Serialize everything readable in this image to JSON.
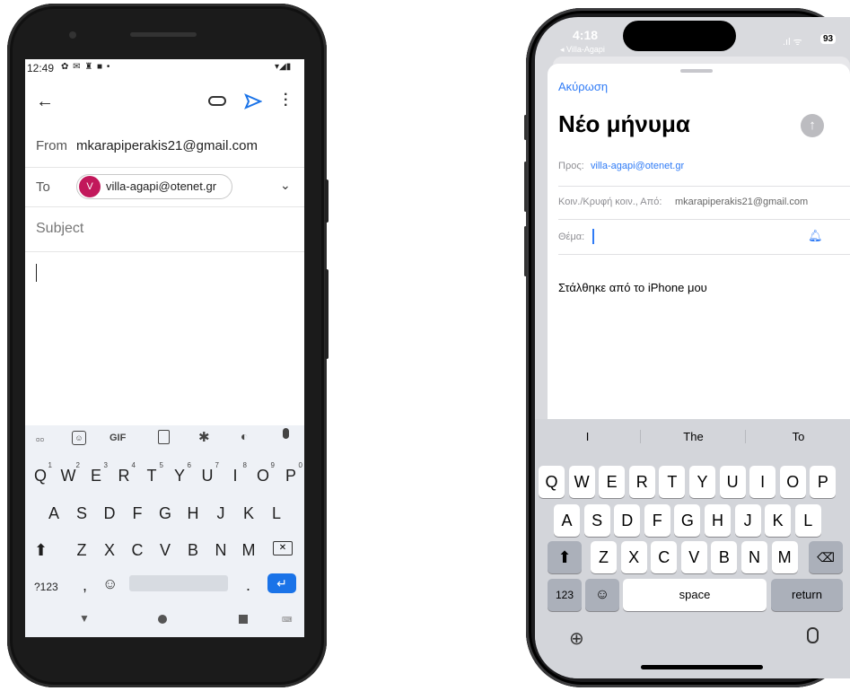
{
  "android": {
    "status": {
      "time": "12:49",
      "icons": "✿ ✉ ♜ ■ •",
      "right_icons": "▾◢▮"
    },
    "toolbar": {
      "back_icon": "arrow-left-icon",
      "attach_icon": "paperclip-icon",
      "send_icon": "send-icon",
      "more_icon": "more-vert-icon"
    },
    "from": {
      "label": "From",
      "value": "mkarapiperakis21@gmail.com"
    },
    "to": {
      "label": "To",
      "avatar_letter": "V",
      "chip": "villa-agapi@otenet.gr"
    },
    "subject_placeholder": "Subject",
    "keyboard": {
      "toolbar_gif": "GIF",
      "row1": [
        {
          "k": "Q",
          "n": "1"
        },
        {
          "k": "W",
          "n": "2"
        },
        {
          "k": "E",
          "n": "3"
        },
        {
          "k": "R",
          "n": "4"
        },
        {
          "k": "T",
          "n": "5"
        },
        {
          "k": "Y",
          "n": "6"
        },
        {
          "k": "U",
          "n": "7"
        },
        {
          "k": "I",
          "n": "8"
        },
        {
          "k": "O",
          "n": "9"
        },
        {
          "k": "P",
          "n": "0"
        }
      ],
      "row2": [
        "A",
        "S",
        "D",
        "F",
        "G",
        "H",
        "J",
        "K",
        "L"
      ],
      "row3": [
        "Z",
        "X",
        "C",
        "V",
        "B",
        "N",
        "M"
      ],
      "sym": "?123",
      "comma": ",",
      "period": "."
    },
    "accent": "#1a73e8",
    "avatar_color": "#c2185b"
  },
  "ios": {
    "status": {
      "time": "4:18",
      "back": "◂ Villa-Agapi",
      "battery": "93"
    },
    "cancel": "Ακύρωση",
    "title": "Νέο μήνυμα",
    "to": {
      "label": "Προς:",
      "value": "villa-agapi@otenet.gr"
    },
    "cc": {
      "label": "Κοιν./Κρυφή κοιν., Από:",
      "value": "mkarapiperakis21@gmail.com"
    },
    "subject_label": "Θέμα:",
    "signature": "Στάλθηκε από το iPhone μου",
    "suggestions": [
      "I",
      "The",
      "To"
    ],
    "row1": [
      "Q",
      "W",
      "E",
      "R",
      "T",
      "Y",
      "U",
      "I",
      "O",
      "P"
    ],
    "row2": [
      "A",
      "S",
      "D",
      "F",
      "G",
      "H",
      "J",
      "K",
      "L"
    ],
    "row3": [
      "Z",
      "X",
      "C",
      "V",
      "B",
      "N",
      "M"
    ],
    "num": "123",
    "space": "space",
    "return": "return",
    "accent": "#2f7bf6"
  }
}
